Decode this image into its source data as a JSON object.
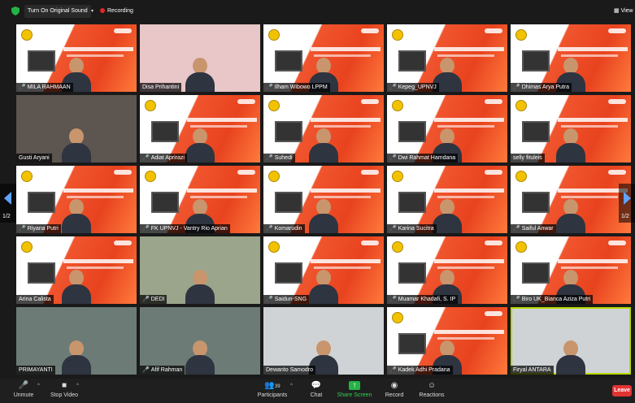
{
  "topbar": {
    "sound_button": "Turn On Original Sound",
    "recording": "Recording",
    "view": "View"
  },
  "pager": {
    "left": "1/2",
    "right": "1/2"
  },
  "participants": [
    {
      "name": "MILA RAHMAAN",
      "muted": true,
      "bg": "slide"
    },
    {
      "name": "Disa Prihantini",
      "muted": false,
      "bg": "pink"
    },
    {
      "name": "Ilham Wibowo LPPM",
      "muted": true,
      "bg": "slide"
    },
    {
      "name": "Kepeg_UPNVJ",
      "muted": true,
      "bg": "slide"
    },
    {
      "name": "Dhimas Arya Putra",
      "muted": true,
      "bg": "slide"
    },
    {
      "name": "Gusti Aryani",
      "muted": false,
      "bg": "plain"
    },
    {
      "name": "Adiat Aprirazi",
      "muted": true,
      "bg": "slide"
    },
    {
      "name": "Suhedi",
      "muted": true,
      "bg": "slide"
    },
    {
      "name": "Dwi Rahmat Hamdana",
      "muted": true,
      "bg": "slide"
    },
    {
      "name": "selly fituleis",
      "muted": false,
      "bg": "slide"
    },
    {
      "name": "Riyana Putri",
      "muted": true,
      "bg": "slide"
    },
    {
      "name": "FK UPNVJ - Vantry Rio Aprian",
      "muted": true,
      "bg": "slide"
    },
    {
      "name": "Komarudin",
      "muted": true,
      "bg": "slide"
    },
    {
      "name": "Karina Sucitra",
      "muted": true,
      "bg": "slide"
    },
    {
      "name": "Saiful Anwar",
      "muted": true,
      "bg": "slide"
    },
    {
      "name": "Arina Calista",
      "muted": false,
      "bg": "slide"
    },
    {
      "name": "DEDI",
      "muted": true,
      "bg": "green"
    },
    {
      "name": "Saidun-SNG",
      "muted": true,
      "bg": "slide"
    },
    {
      "name": "Muamar Khadafi, S. IP",
      "muted": true,
      "bg": "slide"
    },
    {
      "name": "Biro UK_Bianca Aziza Putri",
      "muted": true,
      "bg": "slide"
    },
    {
      "name": "PRIMAYANTI",
      "muted": false,
      "bg": "teal"
    },
    {
      "name": "Afif Rahman",
      "muted": true,
      "bg": "teal"
    },
    {
      "name": "Dewanto Samodro",
      "muted": false,
      "bg": "white"
    },
    {
      "name": "Kadek Adhi Pradana",
      "muted": true,
      "bg": "slide"
    },
    {
      "name": "Firyal ANTARA",
      "muted": false,
      "bg": "white",
      "active": true
    }
  ],
  "toolbar": {
    "unmute": "Unmute",
    "stop_video": "Stop Video",
    "participants": "Participants",
    "participants_count": "39",
    "chat": "Chat",
    "share_screen": "Share Screen",
    "record": "Record",
    "reactions": "Reactions",
    "leave": "Leave"
  },
  "colors": {
    "accent_green": "#25b246",
    "leave_red": "#e23333",
    "recording_red": "#e02828",
    "active_speaker": "#b8d800"
  }
}
